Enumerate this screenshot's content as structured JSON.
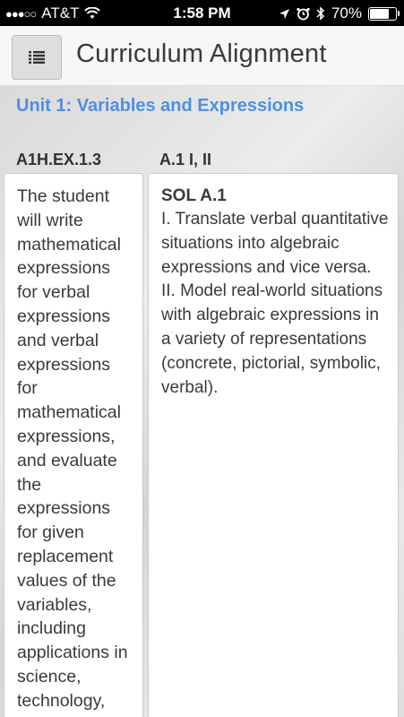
{
  "status": {
    "carrier": "AT&T",
    "time": "1:58 PM",
    "battery": "70%",
    "battery_level": 0.7,
    "signal_dots": "●●●○○"
  },
  "header": {
    "title": "Curriculum Alignment",
    "menu_icon": "list-icon"
  },
  "unit": {
    "title": "Unit 1: Variables and Expressions"
  },
  "columns": {
    "left_header": "A1H.EX.1.3",
    "right_header": "A.1 I, II"
  },
  "left_card": {
    "text": "The student will write mathematical expressions for verbal expressions and verbal expressions for mathematical expressions, and evaluate the expressions for given replacement values of the variables, including applications in science, technology,"
  },
  "right_card": {
    "code": "SOL A.1",
    "line1": "I. Translate verbal quantitative situations into algebraic expressions and vice versa.",
    "line2": "II. Model real-world situations with algebraic expressions in a variety of representations (concrete, pictorial, symbolic, verbal)."
  },
  "colors": {
    "accent": "#4f8fe0",
    "text": "#3a3a3a"
  }
}
